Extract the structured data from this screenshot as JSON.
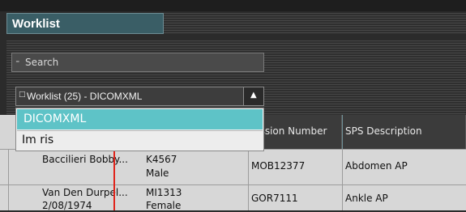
{
  "window": {
    "title": "Worklist"
  },
  "search": {
    "placeholder": "Search",
    "icon": "search-icon"
  },
  "worklist_select": {
    "value": "Worklist (25) - DICOMXML",
    "options": [
      "DICOMXML",
      "Im ris"
    ],
    "selected_option": "DICOMXML"
  },
  "table": {
    "headers": {
      "accession": "Accession Number",
      "sps": "SPS Description"
    },
    "rows": [
      {
        "name": "Baccilieri  Bobby...",
        "dob": "",
        "id": "K4567",
        "sex": "Male",
        "accession": "MOB12377",
        "sps": "Abdomen AP"
      },
      {
        "name": "Van Den Durpel...",
        "dob": "2/08/1974",
        "id": "MI1313",
        "sex": "Female",
        "accession": "GOR7111",
        "sps": "Ankle AP"
      }
    ]
  },
  "colors": {
    "accent": "#5ec3c7",
    "title_tab": "#3a5e66",
    "marker": "#e0241c"
  }
}
